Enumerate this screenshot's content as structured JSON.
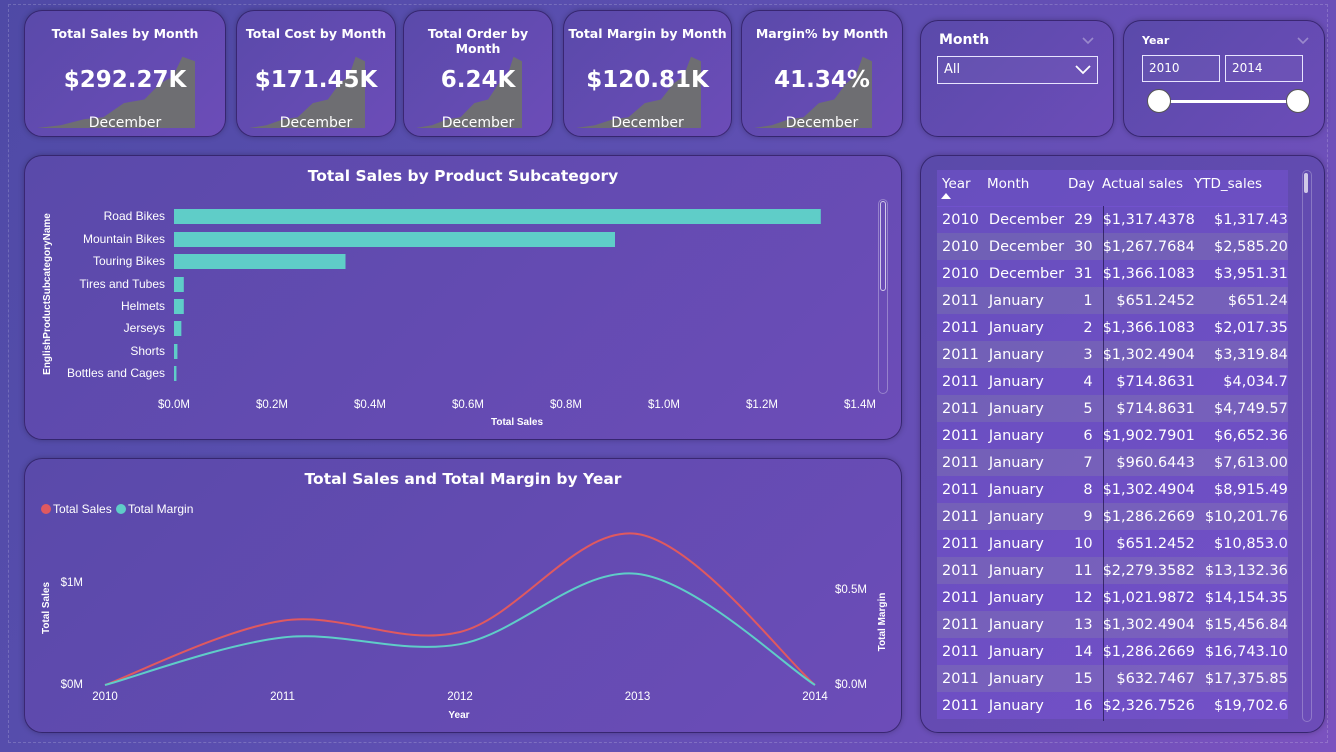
{
  "kpis": [
    {
      "title": "Total Sales by Month",
      "value": "$292.27K",
      "sub": "December"
    },
    {
      "title": "Total Cost by Month",
      "value": "$171.45K",
      "sub": "December"
    },
    {
      "title": "Total Order by Month",
      "value": "6.24K",
      "sub": "December"
    },
    {
      "title": "Total Margin by Month",
      "value": "$120.81K",
      "sub": "December"
    },
    {
      "title": "Margin% by Month",
      "value": "41.34%",
      "sub": "December"
    }
  ],
  "slicers": {
    "month": {
      "title": "Month",
      "selected": "All"
    },
    "year": {
      "title": "Year",
      "start": "2010",
      "end": "2014",
      "range": [
        2010,
        2014
      ]
    }
  },
  "bar_chart": {
    "title": "Total Sales by Product Subcategory"
  },
  "line_chart": {
    "title": "Total Sales and Total Margin by Year"
  },
  "colors": {
    "bar": "#5fcdc8",
    "sales": "#e0595f",
    "margin": "#5fcdc8",
    "kpi_area": "#6e6e72"
  },
  "icons": {
    "dropdown": "chevron-down-icon",
    "sort": "sort-ascending-icon"
  },
  "chart_data": [
    {
      "type": "bar",
      "orientation": "horizontal",
      "title": "Total Sales by Product Subcategory",
      "categories": [
        "Road Bikes",
        "Mountain Bikes",
        "Touring Bikes",
        "Tires and Tubes",
        "Helmets",
        "Jerseys",
        "Shorts",
        "Bottles and Cages"
      ],
      "values": [
        1.32,
        0.9,
        0.35,
        0.02,
        0.02,
        0.015,
        0.007,
        0.005
      ],
      "xlabel": "Total Sales",
      "ylabel": "EnglishProductSubcategoryName",
      "xticks": [
        "$0.0M",
        "$0.2M",
        "$0.4M",
        "$0.6M",
        "$0.8M",
        "$1.0M",
        "$1.2M",
        "$1.4M"
      ],
      "xlim": [
        0,
        1.4
      ],
      "unit": "M"
    },
    {
      "type": "line",
      "title": "Total Sales and Total Margin by Year",
      "x": [
        2010,
        2011,
        2012,
        2013,
        2014
      ],
      "series": [
        {
          "name": "Total Sales",
          "axis": "left",
          "values": [
            0,
            0.63,
            0.52,
            1.48,
            0
          ]
        },
        {
          "name": "Total Margin",
          "axis": "right",
          "values": [
            0,
            0.25,
            0.215,
            0.585,
            0
          ]
        }
      ],
      "xlabel": "Year",
      "ylabel_left": "Total Sales",
      "ylabel_right": "Total Margin",
      "yticks_left": [
        "$0M",
        "$1M"
      ],
      "yticks_right": [
        "$0.0M",
        "$0.5M"
      ],
      "ylim_left": [
        0,
        1.0
      ],
      "ylim_right": [
        0,
        0.5
      ],
      "legend": "top-left"
    }
  ],
  "table": {
    "columns": [
      "Year",
      "Month",
      "Day",
      "Actual sales",
      "YTD_sales"
    ],
    "rows": [
      [
        "2010",
        "December",
        "29",
        "$1,317.4378",
        "$1,317.4378"
      ],
      [
        "2010",
        "December",
        "30",
        "$1,267.7684",
        "$2,585.2062"
      ],
      [
        "2010",
        "December",
        "31",
        "$1,366.1083",
        "$3,951.3145"
      ],
      [
        "2011",
        "January",
        "1",
        "$651.2452",
        "$651.2452"
      ],
      [
        "2011",
        "January",
        "2",
        "$1,366.1083",
        "$2,017.3535"
      ],
      [
        "2011",
        "January",
        "3",
        "$1,302.4904",
        "$3,319.8439"
      ],
      [
        "2011",
        "January",
        "4",
        "$714.8631",
        "$4,034.707"
      ],
      [
        "2011",
        "January",
        "5",
        "$714.8631",
        "$4,749.5701"
      ],
      [
        "2011",
        "January",
        "6",
        "$1,902.7901",
        "$6,652.3602"
      ],
      [
        "2011",
        "January",
        "7",
        "$960.6443",
        "$7,613.0045"
      ],
      [
        "2011",
        "January",
        "8",
        "$1,302.4904",
        "$8,915.4949"
      ],
      [
        "2011",
        "January",
        "9",
        "$1,286.2669",
        "$10,201.7618"
      ],
      [
        "2011",
        "January",
        "10",
        "$651.2452",
        "$10,853.007"
      ],
      [
        "2011",
        "January",
        "11",
        "$2,279.3582",
        "$13,132.3652"
      ],
      [
        "2011",
        "January",
        "12",
        "$1,021.9872",
        "$14,154.3524"
      ],
      [
        "2011",
        "January",
        "13",
        "$1,302.4904",
        "$15,456.8428"
      ],
      [
        "2011",
        "January",
        "14",
        "$1,286.2669",
        "$16,743.1097"
      ],
      [
        "2011",
        "January",
        "15",
        "$632.7467",
        "$17,375.8564"
      ],
      [
        "2011",
        "January",
        "16",
        "$2,326.7526",
        "$19,702.609"
      ]
    ]
  }
}
